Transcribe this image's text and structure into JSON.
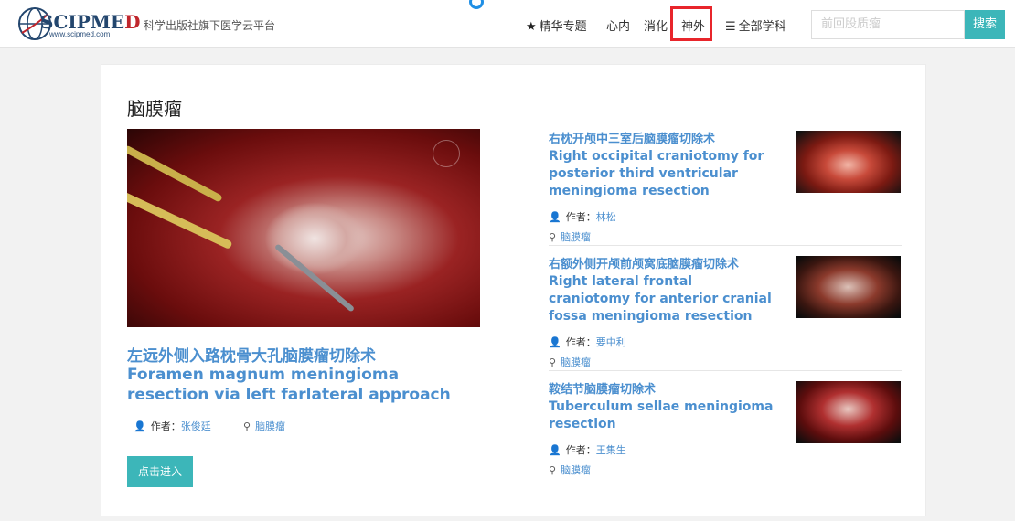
{
  "header": {
    "logo_text_main": "SCIPME",
    "logo_text_end": "D",
    "logo_url": "www.scipmed.com",
    "tagline": "科学出版社旗下医学云平台",
    "nav": {
      "featured": "精华专题",
      "cardiology": "心内",
      "digestive": "消化",
      "neurosurgery": "神外",
      "all_subjects": "全部学科"
    },
    "search": {
      "placeholder": "前回股质瘤",
      "button": "搜索"
    }
  },
  "main": {
    "section_title": "脑膜瘤",
    "feature": {
      "title_cn": "左远外侧入路枕骨大孔脑膜瘤切除术",
      "title_en": "Foramen magnum meningioma resection via left farlateral approach",
      "author_label": "作者：",
      "author": "张俊廷",
      "tag": "脑膜瘤",
      "enter_button": "点击进入"
    },
    "articles": [
      {
        "title_cn": "右枕开颅中三室后脑膜瘤切除术",
        "title_en": "Right occipital craniotomy for posterior third ventricular meningioma resection",
        "author_label": "作者：",
        "author": "林松",
        "tag": "脑膜瘤"
      },
      {
        "title_cn": "右额外侧开颅前颅窝底脑膜瘤切除术",
        "title_en": "Right lateral frontal craniotomy for anterior cranial fossa meningioma resection",
        "author_label": "作者：",
        "author": "要中利",
        "tag": "脑膜瘤"
      },
      {
        "title_cn": "鞍结节脑膜瘤切除术",
        "title_en": "Tuberculum sellae meningioma resection",
        "author_label": "作者：",
        "author": "王集生",
        "tag": "脑膜瘤"
      }
    ]
  },
  "colors": {
    "accent_teal": "#3cb6b9",
    "link_blue": "#4b8fcf",
    "highlight_red": "#e8252b"
  }
}
